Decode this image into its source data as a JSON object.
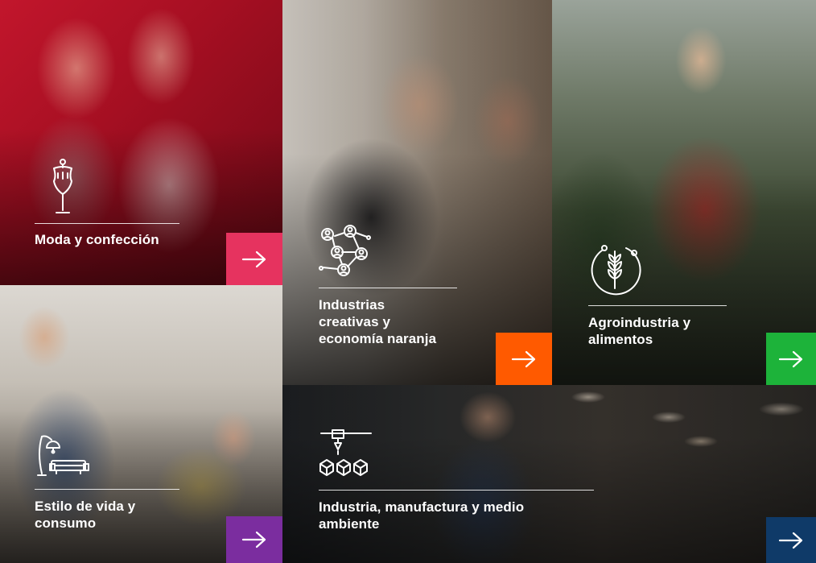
{
  "tiles": [
    {
      "id": "moda",
      "label": "Moda y confección",
      "icon": "mannequin-icon",
      "accent": "#e6335f"
    },
    {
      "id": "creativas",
      "label": "Industrias creativas y economía naranja",
      "label_lines": [
        "Industrias",
        "creativas y",
        "economía naranja"
      ],
      "icon": "network-people-icon",
      "accent": "#ff5a00"
    },
    {
      "id": "agro",
      "label": "Agroindustria y alimentos",
      "label_lines": [
        "Agroindustria y",
        "alimentos"
      ],
      "icon": "wheat-icon",
      "accent": "#1db33a"
    },
    {
      "id": "estilo",
      "label": "Estilo de vida y consumo",
      "label_lines": [
        "Estilo de vida y",
        "consumo"
      ],
      "icon": "lamp-sofa-icon",
      "accent": "#7b2d9f"
    },
    {
      "id": "manufactura",
      "label": "Industria, manufactura y medio ambiente",
      "label_lines": [
        "Industria, manufactura y medio",
        "ambiente"
      ],
      "icon": "industrial-boxes-icon",
      "accent": "#0f3a68"
    }
  ],
  "arrow_icon": "arrow-right-icon"
}
